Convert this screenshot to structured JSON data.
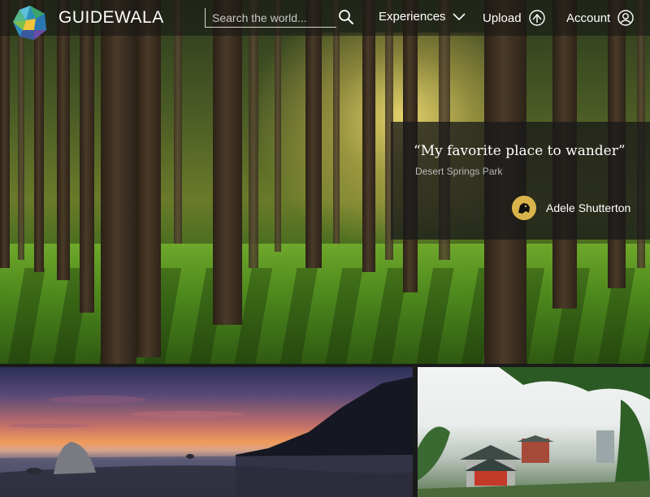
{
  "brand": {
    "name": "GUIDEWALA",
    "logo_icon": "geodesic-globe-icon"
  },
  "search": {
    "placeholder": "Search the world...",
    "icon": "search-icon"
  },
  "nav": {
    "experiences_label": "Experiences",
    "upload_label": "Upload",
    "account_label": "Account"
  },
  "featured": {
    "quote": "“My favorite place to wander”",
    "place": "Desert Springs Park",
    "author": "Adele Shutterton"
  },
  "colors": {
    "accent_gold": "#d8b44a",
    "nav_overlay": "#141414"
  }
}
